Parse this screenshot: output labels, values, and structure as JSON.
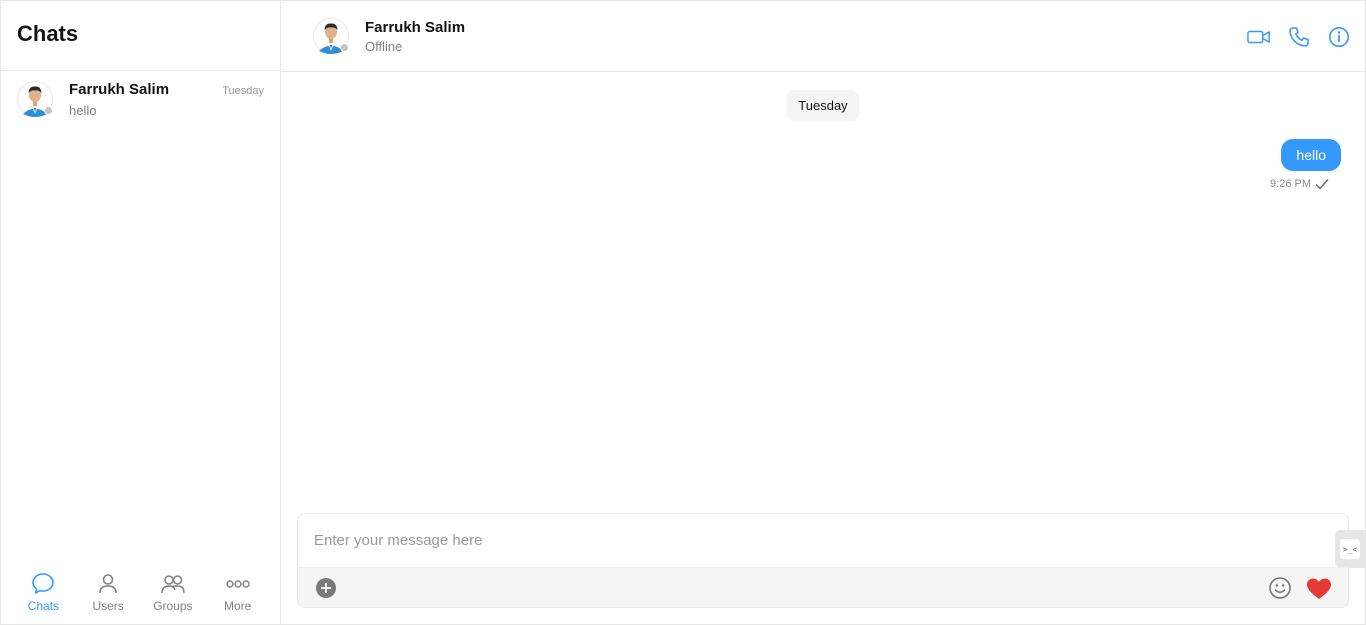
{
  "sidebar": {
    "title": "Chats",
    "chats": [
      {
        "name": "Farrukh Salim",
        "preview": "hello",
        "time": "Tuesday"
      }
    ],
    "nav": [
      {
        "label": "Chats",
        "icon": "chat-bubble-icon",
        "active": true
      },
      {
        "label": "Users",
        "icon": "user-icon",
        "active": false
      },
      {
        "label": "Groups",
        "icon": "groups-icon",
        "active": false
      },
      {
        "label": "More",
        "icon": "more-icon",
        "active": false
      }
    ]
  },
  "header": {
    "name": "Farrukh Salim",
    "status": "Offline",
    "actions": [
      "video-call-icon",
      "phone-icon",
      "info-icon"
    ]
  },
  "messages": {
    "date_separator": "Tuesday",
    "items": [
      {
        "text": "hello",
        "time": "9:26 PM",
        "outgoing": true,
        "status": "sent"
      }
    ]
  },
  "composer": {
    "placeholder": "Enter your message here"
  },
  "colors": {
    "accent": "#3399ff",
    "heart": "#e53935",
    "presence_offline": "#c4c4c4"
  }
}
